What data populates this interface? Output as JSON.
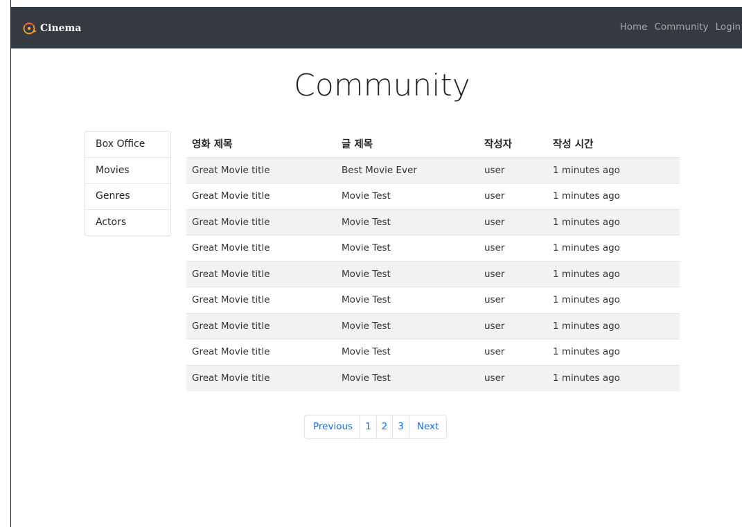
{
  "brand": {
    "name": "Cinema",
    "logo_icon": "film-reel-icon",
    "logo_color": "#f5a623"
  },
  "nav": {
    "links": [
      "Home",
      "Community",
      "Login"
    ]
  },
  "page_title": "Community",
  "sidebar": {
    "items": [
      "Box Office",
      "Movies",
      "Genres",
      "Actors"
    ]
  },
  "table": {
    "headers": [
      "영화 제목",
      "글 제목",
      "작성자",
      "작성 시간"
    ],
    "rows": [
      [
        "Great Movie title",
        "Best Movie Ever",
        "user",
        "1 minutes ago"
      ],
      [
        "Great Movie title",
        "Movie Test",
        "user",
        "1 minutes ago"
      ],
      [
        "Great Movie title",
        "Movie Test",
        "user",
        "1 minutes ago"
      ],
      [
        "Great Movie title",
        "Movie Test",
        "user",
        "1 minutes ago"
      ],
      [
        "Great Movie title",
        "Movie Test",
        "user",
        "1 minutes ago"
      ],
      [
        "Great Movie title",
        "Movie Test",
        "user",
        "1 minutes ago"
      ],
      [
        "Great Movie title",
        "Movie Test",
        "user",
        "1 minutes ago"
      ],
      [
        "Great Movie title",
        "Movie Test",
        "user",
        "1 minutes ago"
      ],
      [
        "Great Movie title",
        "Movie Test",
        "user",
        "1 minutes ago"
      ]
    ]
  },
  "pagination": {
    "previous": "Previous",
    "pages": [
      "1",
      "2",
      "3"
    ],
    "next": "Next"
  },
  "colors": {
    "navbar_bg": "#343a40",
    "link": "#0d6efd",
    "striped_row": "#f2f2f2"
  }
}
